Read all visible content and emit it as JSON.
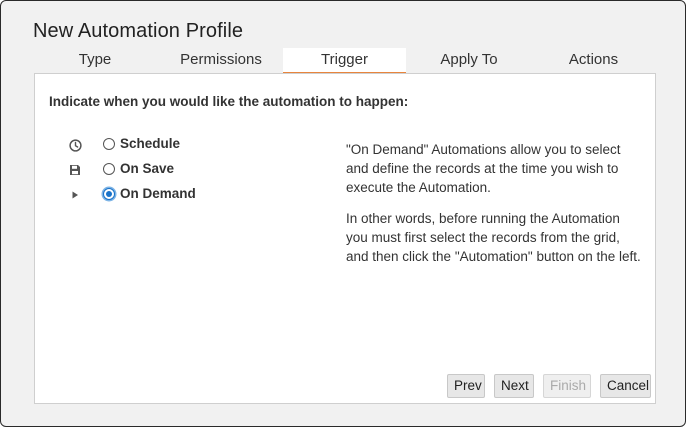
{
  "dialog": {
    "title": "New Automation Profile"
  },
  "tabs": [
    {
      "label": "Type"
    },
    {
      "label": "Permissions"
    },
    {
      "label": "Trigger",
      "active": true
    },
    {
      "label": "Apply To"
    },
    {
      "label": "Actions"
    }
  ],
  "trigger": {
    "prompt": "Indicate when you would like the automation to happen:",
    "options": [
      {
        "label": "Schedule",
        "icon": "clock-icon",
        "selected": false
      },
      {
        "label": "On Save",
        "icon": "save-icon",
        "selected": false
      },
      {
        "label": "On Demand",
        "icon": "play-icon",
        "selected": true
      }
    ],
    "description": [
      "\"On Demand\" Automations allow you to select and define the records at the time you wish to execute the Automation.",
      "In other words, before running the Automation you must first select the records from the grid, and then click the \"Automation\" button on the left."
    ]
  },
  "buttons": {
    "prev": "Prev",
    "next": "Next",
    "finish": "Finish",
    "cancel": "Cancel"
  },
  "colors": {
    "accent": "#e8853d",
    "radio_selected": "#1a73c9"
  }
}
